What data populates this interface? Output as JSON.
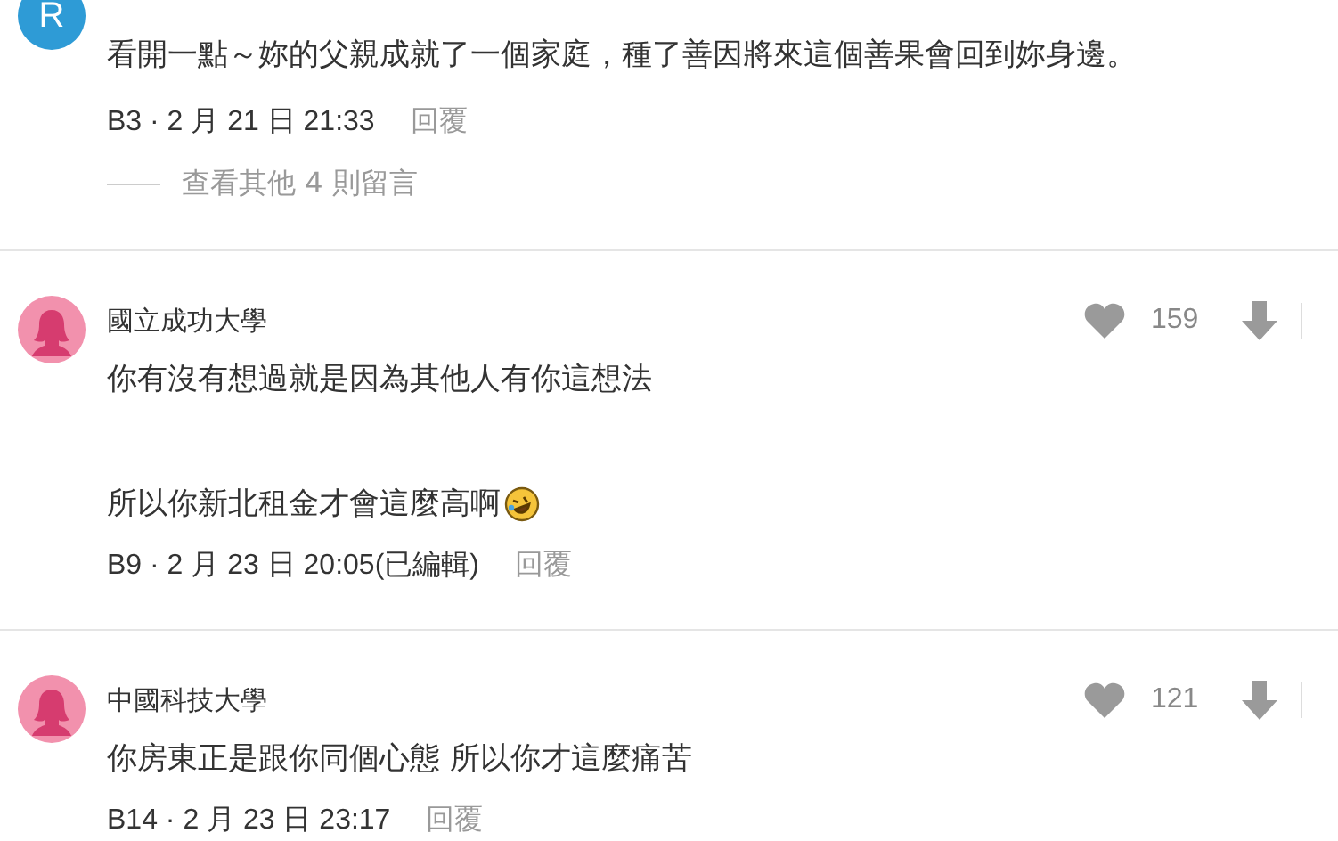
{
  "comments": [
    {
      "avatar": {
        "kind": "letter",
        "letter": "R",
        "color": "#2e9bd6"
      },
      "paragraphs": [
        {
          "text": "看開一點～妳的父親成就了一個家庭，種了善因將來這個善果會回到妳身邊。",
          "emoji": false
        }
      ],
      "floor": "B3 ·",
      "date": "2 月 21 日 21:33",
      "reply": "回覆",
      "more_replies": "查看其他 4 則留言"
    },
    {
      "avatar": {
        "kind": "silhouette",
        "color": "#f291ad"
      },
      "author": "國立成功大學",
      "likes": "159",
      "paragraphs": [
        {
          "text": "你有沒有想過就是因為其他人有你這想法",
          "emoji": false
        },
        {
          "text": "所以你新北租金才會這麼高啊",
          "emoji": true
        }
      ],
      "floor": "B9 ·",
      "date": "2 月 23 日 20:05",
      "edited": "(已編輯)",
      "reply": "回覆"
    },
    {
      "avatar": {
        "kind": "silhouette",
        "color": "#f291ad"
      },
      "author": "中國科技大學",
      "likes": "121",
      "paragraphs": [
        {
          "text": "你房東正是跟你同個心態 所以你才這麼痛苦",
          "emoji": false
        }
      ],
      "floor": "B14 ·",
      "date": "2 月 23 日 23:17",
      "reply": "回覆"
    }
  ]
}
